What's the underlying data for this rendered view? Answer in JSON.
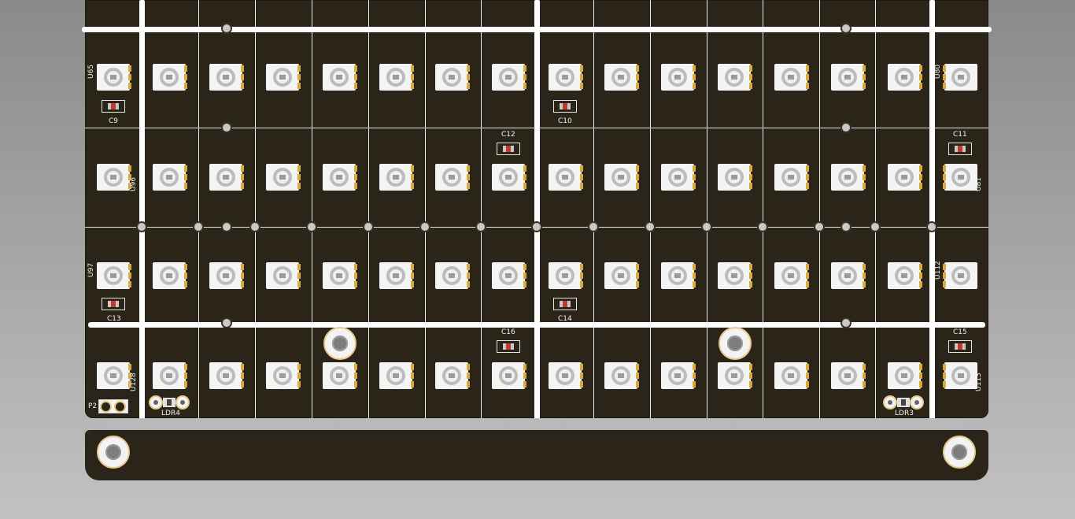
{
  "board": {
    "colors": {
      "substrate": "#2b2418",
      "silkscreen": "#ffffff",
      "pad": "#d9a93a",
      "background": "#9a9a9a"
    },
    "led_rows": 4,
    "led_cols": 16,
    "labels": {
      "U65": "U65",
      "U80": "U80",
      "U96": "U96",
      "U81": "U81",
      "U97": "U97",
      "U112": "U112",
      "U128": "U128",
      "U113": "U113",
      "C9": "C9",
      "C10": "C10",
      "C11": "C11",
      "C12": "C12",
      "C13": "C13",
      "C14": "C14",
      "C15": "C15",
      "C16": "C16",
      "LDR4": "LDR4",
      "LDR3": "LDR3",
      "P2": "P2"
    }
  }
}
